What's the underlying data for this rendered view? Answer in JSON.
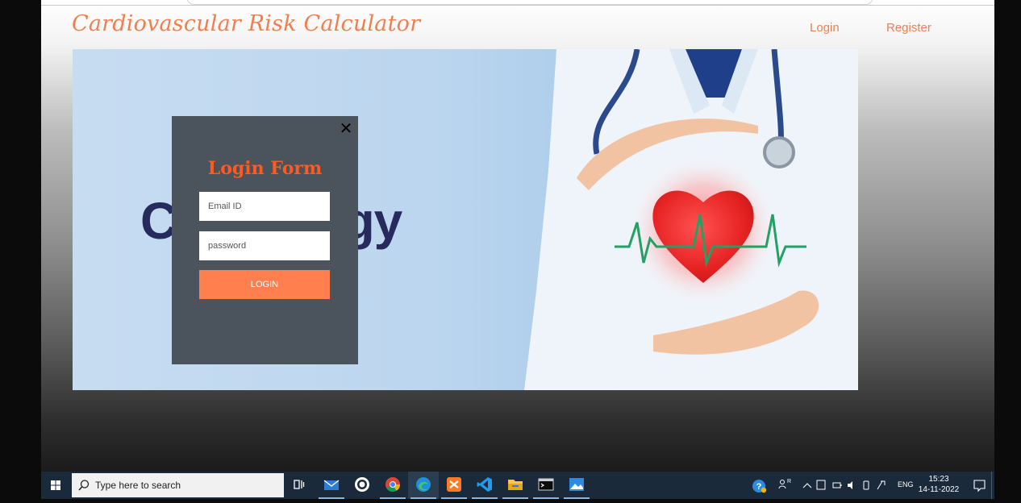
{
  "site": {
    "brand": "Cardiovascular Risk Calculator",
    "nav": {
      "login": "Login",
      "register": "Register"
    }
  },
  "hero": {
    "word": "Cardiology"
  },
  "login_modal": {
    "close_symbol": "✕",
    "title": "Login Form",
    "email_placeholder": "Email ID",
    "password_placeholder": "password",
    "submit_label": "LOGIN"
  },
  "taskbar": {
    "search_placeholder": "Type here to search",
    "apps": [
      "task-view",
      "mail",
      "github-desktop",
      "chrome",
      "edge",
      "xampp",
      "vscode",
      "file-explorer",
      "terminal",
      "photos"
    ],
    "tray_lang": "ENG",
    "time": "15:23",
    "date": "14-11-2022"
  },
  "colors": {
    "accent": "#f07f4f",
    "modal_bg": "#4b535d",
    "button": "#ff7f4f",
    "taskbar": "#1a2a3b"
  }
}
